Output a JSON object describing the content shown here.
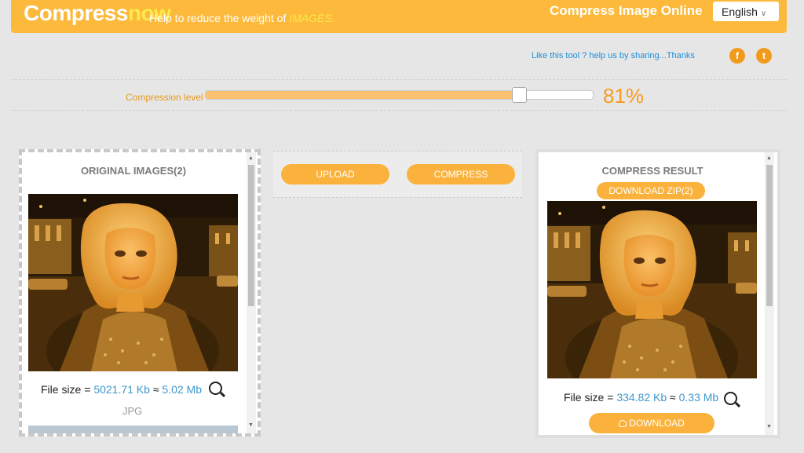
{
  "header": {
    "logo_main": "Compress",
    "logo_accent": "now",
    "tagline_prefix": "Help to reduce the weight of",
    "tagline_highlight": "IMAGES.",
    "title": "Compress Image Online",
    "language": "English"
  },
  "share": {
    "text": "Like this tool ? help us by sharing...Thanks",
    "facebook_glyph": "f",
    "twitter_glyph": "t"
  },
  "compression": {
    "label": "Compression level",
    "value_text": "81%",
    "level_fraction": 0.81
  },
  "original": {
    "title": "ORIGINAL IMAGES(2)",
    "file_size_label": "File size =",
    "size_kb": "5021.71 Kb",
    "approx": "≈",
    "size_mb": "5.02 Mb",
    "format": "JPG"
  },
  "actions": {
    "upload": "UPLOAD",
    "compress": "COMPRESS"
  },
  "result": {
    "title": "COMPRESS RESULT",
    "download_zip": "DOWNLOAD ZIP(2)",
    "file_size_label": "File size =",
    "size_kb": "334.82 Kb",
    "approx": "≈",
    "size_mb": "0.33 Mb",
    "download": "DOWNLOAD"
  },
  "colors": {
    "accent": "#fcb93b",
    "link": "#3f97cf",
    "percent": "#f79a1f"
  }
}
